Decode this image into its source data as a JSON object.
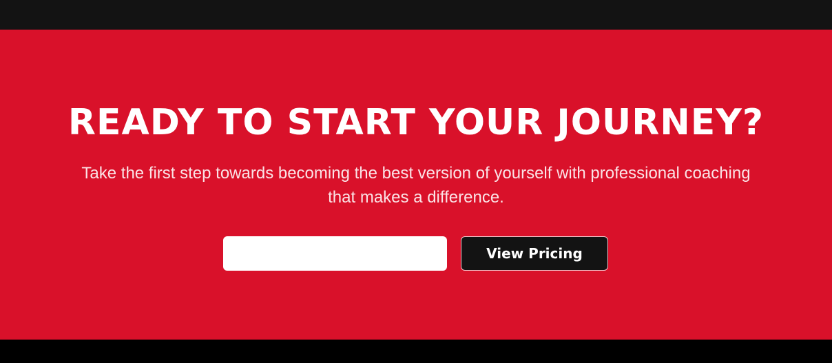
{
  "cta": {
    "title": "READY TO START YOUR JOURNEY?",
    "subtitle_line1": "Take the first step towards becoming the best version of yourself with professional coaching",
    "subtitle_line2": "that makes a difference.",
    "email_input_value": "",
    "pricing_button_label": "View Pricing"
  },
  "colors": {
    "accent_red": "#d9112a",
    "button_dark": "#131313",
    "top_bar": "#131313",
    "bottom_bar": "#000000"
  }
}
